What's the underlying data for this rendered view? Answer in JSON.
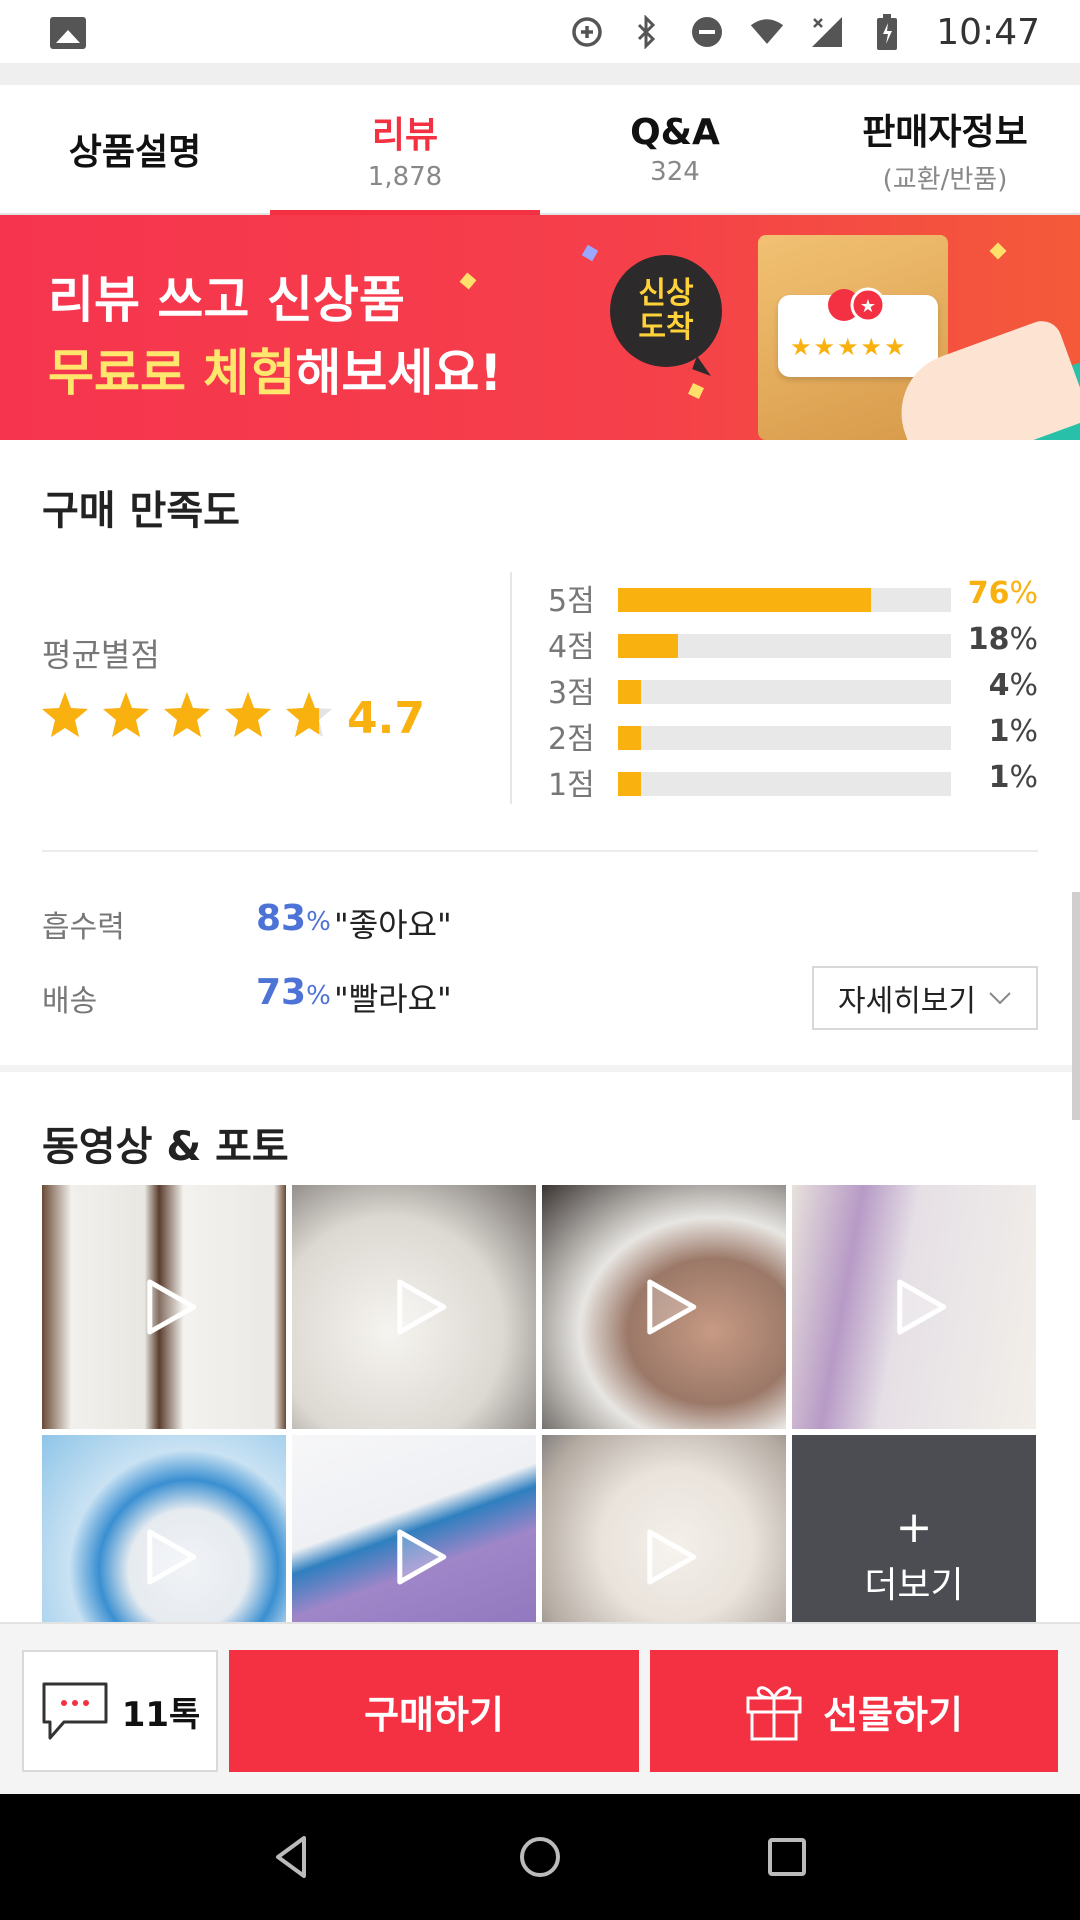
{
  "status_bar": {
    "time": "10:47",
    "icons": [
      "image-icon",
      "data-saver-icon",
      "bluetooth-icon",
      "do-not-disturb-icon",
      "wifi-icon",
      "signal-icon",
      "battery-icon"
    ]
  },
  "tabs": [
    {
      "label": "상품설명",
      "sub": ""
    },
    {
      "label": "리뷰",
      "sub": "1,878"
    },
    {
      "label": "Q&A",
      "sub": "324"
    },
    {
      "label": "판매자정보",
      "sub": "(교환/반품)"
    }
  ],
  "active_tab": "리뷰",
  "banner": {
    "line1": "리뷰 쓰고 신상품",
    "line2_highlight": "무료로 체험",
    "line2_rest": "해보세요!",
    "bubble_line1": "신상",
    "bubble_line2": "도착"
  },
  "satisfaction": {
    "title": "구매 만족도",
    "average_label": "평균별점",
    "average_value": "4.7",
    "average_stars": 4.7,
    "distribution": [
      {
        "label": "5점",
        "percent": 76,
        "pct_num": "76"
      },
      {
        "label": "4점",
        "percent": 18,
        "pct_num": "18"
      },
      {
        "label": "3점",
        "percent": 4,
        "pct_num": "4"
      },
      {
        "label": "2점",
        "percent": 1,
        "pct_num": "1"
      },
      {
        "label": "1점",
        "percent": 1,
        "pct_num": "1"
      }
    ],
    "percent_sign": "%",
    "attributes": [
      {
        "name": "흡수력",
        "percent": "83",
        "text": "\"좋아요\""
      },
      {
        "name": "배송",
        "percent": "73",
        "text": "\"빨라요\""
      }
    ],
    "detail_button": "자세히보기"
  },
  "media": {
    "title": "동영상 & 포토",
    "more_plus": "+",
    "more_label": "더보기"
  },
  "actions": {
    "talk_label": "11톡",
    "buy_label": "구매하기",
    "gift_label": "선물하기"
  },
  "colors": {
    "accent": "#f43142",
    "star": "#f9b10f",
    "attribute_blue": "#4e73d7"
  }
}
